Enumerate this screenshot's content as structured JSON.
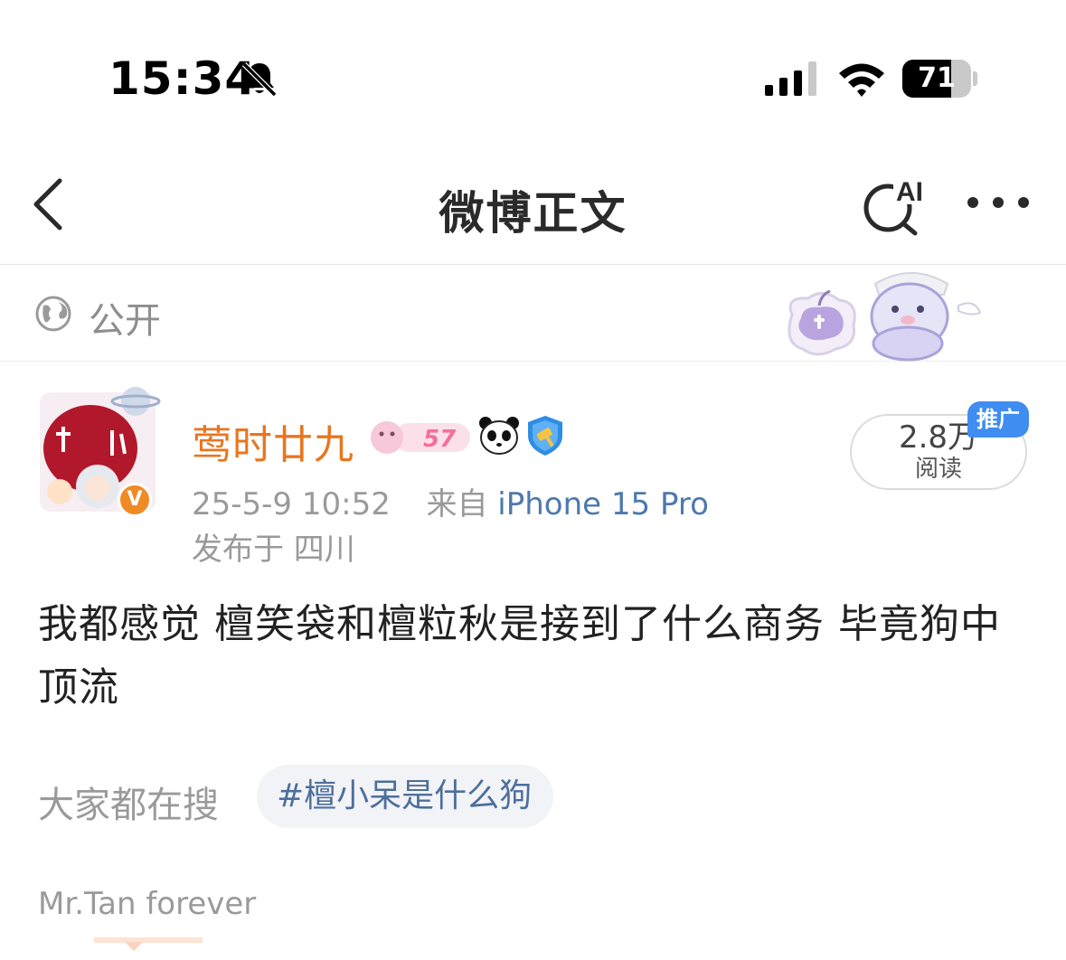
{
  "status_bar": {
    "time": "15:34",
    "battery_level": 71,
    "battery_text": "71",
    "icons": [
      "bell-slash-icon",
      "signal-icon",
      "wifi-icon",
      "battery-icon"
    ]
  },
  "nav": {
    "title": "微博正文",
    "ai_label": "AI",
    "icons": [
      "back-chevron-icon",
      "ai-search-icon",
      "more-dots-icon"
    ]
  },
  "visibility": {
    "label": "公开",
    "icon": "globe-icon"
  },
  "post": {
    "author": {
      "name": "莺时廿九",
      "name_color": "#e8761f",
      "verified_mark": "V",
      "level_badge": "57",
      "badge_icons": [
        "level-badge-icon",
        "panda-icon",
        "shield-icon"
      ]
    },
    "meta": {
      "date": "25-5-9 10:52",
      "source_prefix": "来自",
      "source": "iPhone 15 Pro",
      "location": "发布于 四川"
    },
    "reads": {
      "count": "2.8万",
      "label": "阅读",
      "promo_tag": "推广"
    },
    "text": "我都感觉 檀笑袋和檀粒秋是接到了什么商务 毕竟狗中顶流",
    "search": {
      "label": "大家都在搜",
      "chip": "#檀小呆是什么狗"
    },
    "footer": "Mr.Tan forever"
  },
  "colors": {
    "accent_blue": "#3f8df0",
    "link_blue": "#4d79ad",
    "meta_gray": "#9a9a9a"
  }
}
